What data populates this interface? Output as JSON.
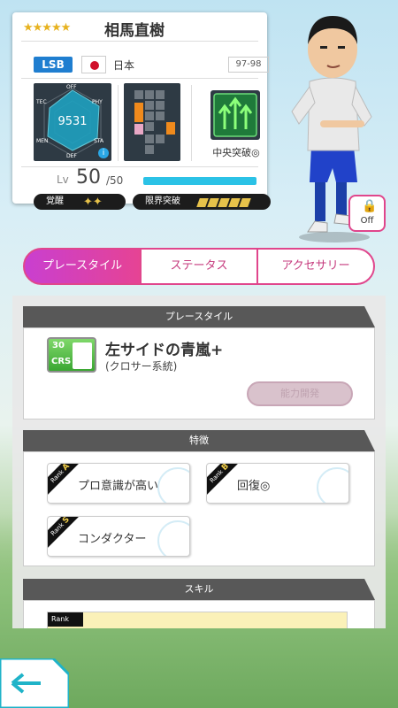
{
  "card": {
    "stars": "★★★★★",
    "name": "相馬直樹",
    "position": "LSB",
    "country": "日本",
    "season": "97-98",
    "radar": {
      "total": "9531",
      "labels": {
        "off": "OFF",
        "phy": "PHY",
        "sta": "STA",
        "def": "DEF",
        "men": "MEN",
        "tec": "TEC"
      },
      "info": "i"
    },
    "tactic": "中央突破◎",
    "level": {
      "prefix": "Lv",
      "value": "50",
      "max": "/50",
      "progress": 1.0
    },
    "awakening": {
      "label": "覚醒",
      "mark": "✦✦"
    },
    "limit_break": {
      "label": "限界突破",
      "count": 5
    }
  },
  "toggle": {
    "label": "Off"
  },
  "tabs": [
    "プレースタイル",
    "ステータス",
    "アクセサリー"
  ],
  "playstyle": {
    "header": "プレースタイル",
    "icon_value": "30",
    "icon_code": "CRS",
    "name": "左サイドの青嵐+",
    "type": "(クロサー系統)",
    "develop_button": "能力開発"
  },
  "traits": {
    "header": "特徴",
    "items": [
      {
        "rank_prefix": "Rank",
        "rank": "A",
        "name": "プロ意識が高い"
      },
      {
        "rank_prefix": "Rank",
        "rank": "B",
        "name": "回復◎"
      },
      {
        "rank_prefix": "Rank",
        "rank": "S",
        "name": "コンダクター"
      }
    ]
  },
  "skills": {
    "header": "スキル",
    "rank_prefix": "Rank"
  },
  "colors": {
    "accent": "#e0468c",
    "gold": "#e7b21f",
    "position_blue": "#1f7ed0"
  }
}
